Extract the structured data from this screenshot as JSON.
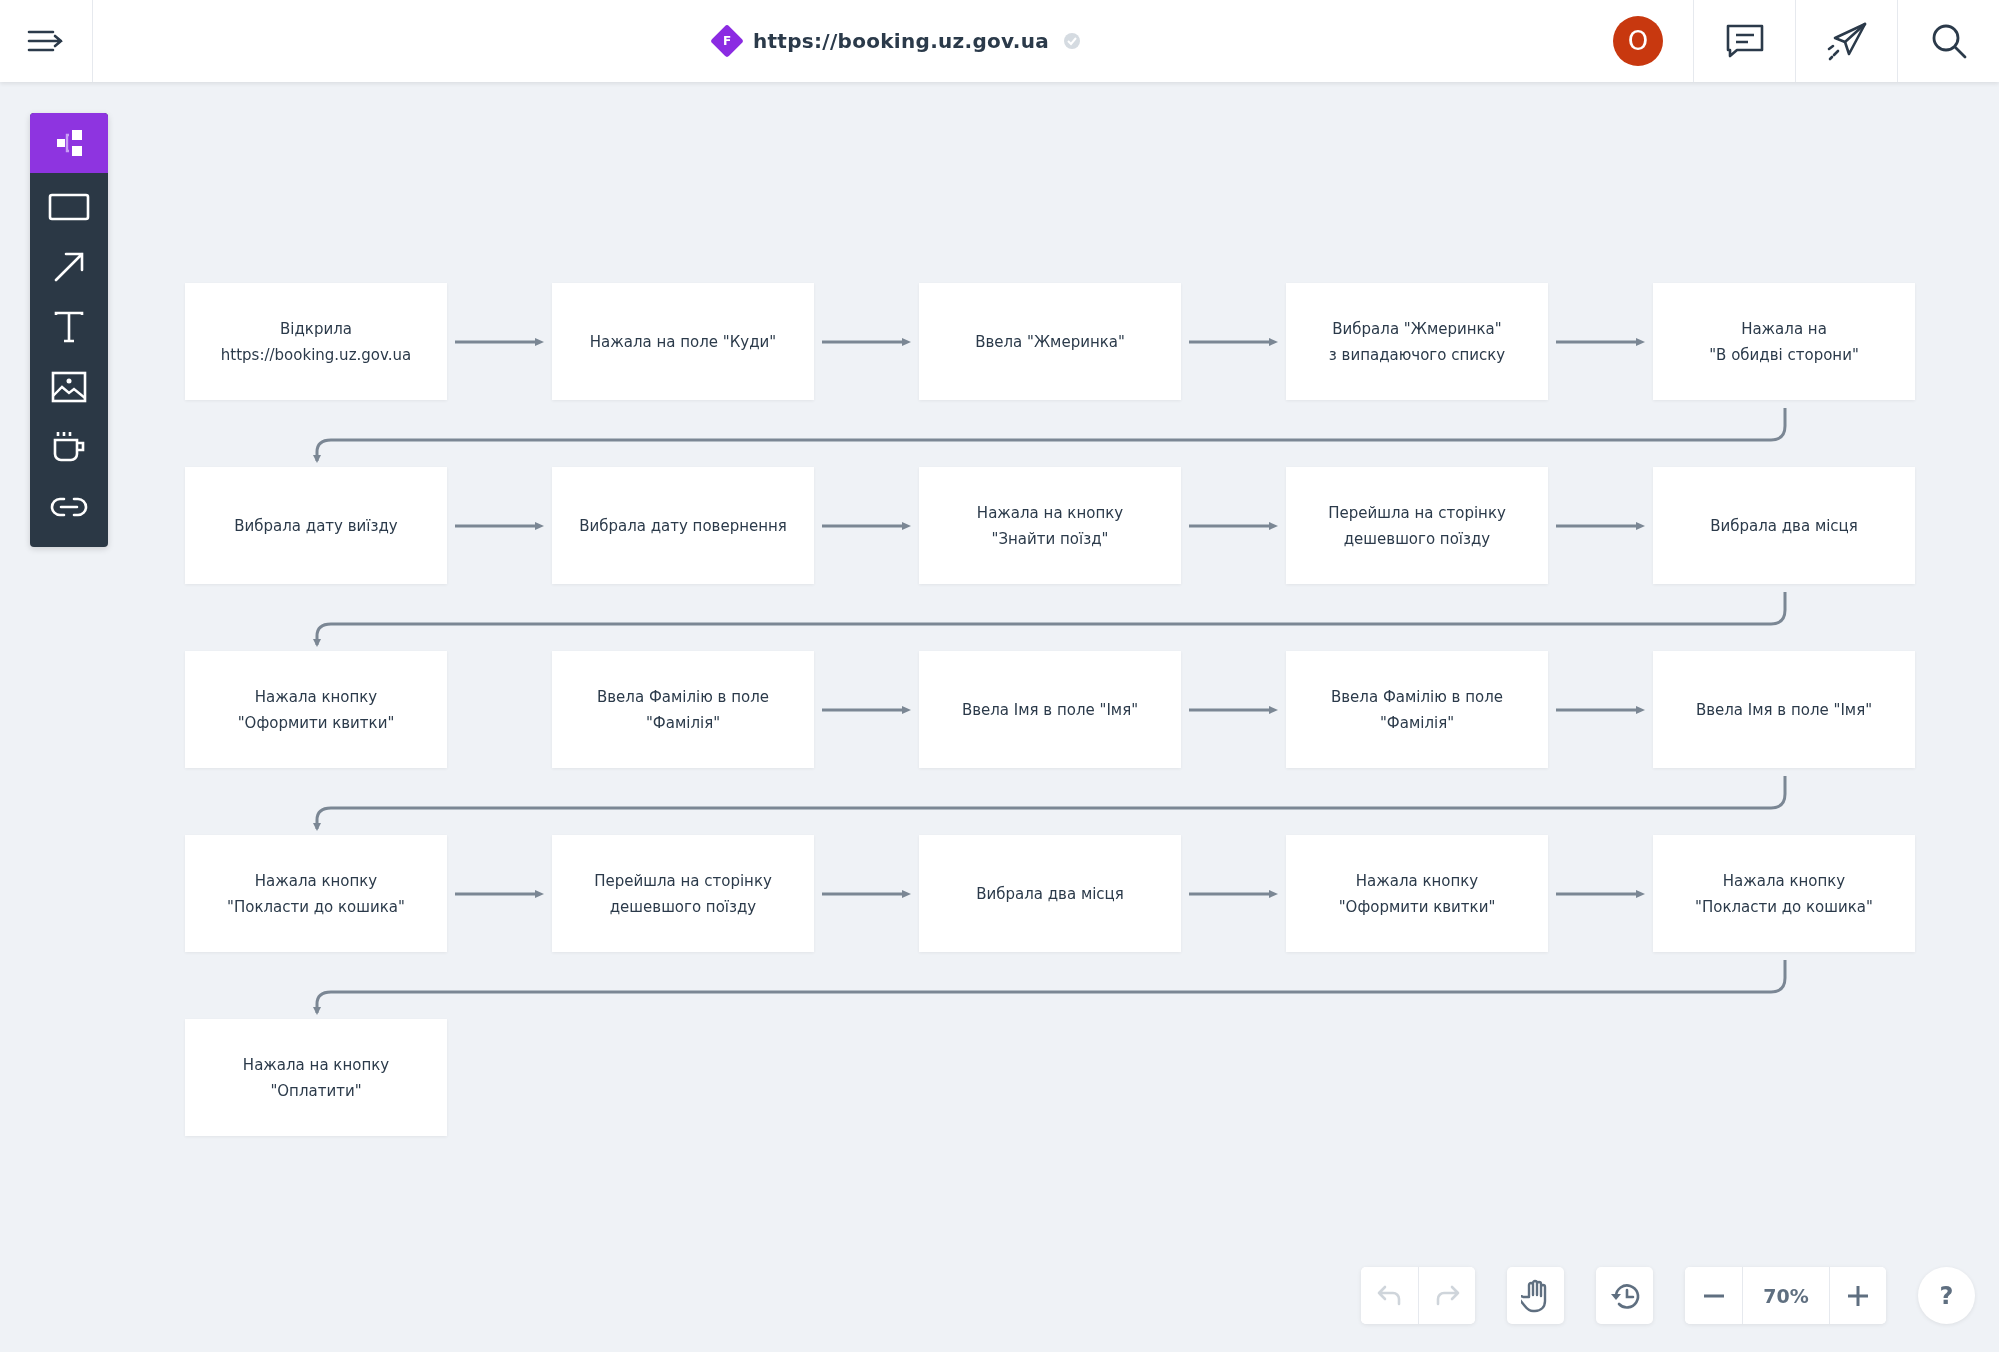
{
  "header": {
    "url": "https://booking.uz.gov.ua",
    "logo_letter": "F",
    "avatar_letter": "O"
  },
  "tools": [
    {
      "kind": "diagram",
      "selected": true
    },
    {
      "kind": "rectangle",
      "selected": false
    },
    {
      "kind": "arrow",
      "selected": false
    },
    {
      "kind": "text",
      "selected": false
    },
    {
      "kind": "image",
      "selected": false
    },
    {
      "kind": "cup",
      "selected": false
    },
    {
      "kind": "link",
      "selected": false
    }
  ],
  "diagram": {
    "rows": [
      {
        "nodes": [
          {
            "text": "Відкрила\nhttps://booking.uz.gov.ua",
            "arrow_to_next": true
          },
          {
            "text": "Нажала на поле \"Куди\"",
            "arrow_to_next": true
          },
          {
            "text": "Ввела \"Жмеринка\"",
            "arrow_to_next": true
          },
          {
            "text": "Вибрала \"Жмеринка\"\nз випадаючого списку",
            "arrow_to_next": true
          },
          {
            "text": "Нажала на\n\"В обидві сторони\"",
            "arrow_to_next": false
          }
        ]
      },
      {
        "nodes": [
          {
            "text": "Вибрала дату виїзду",
            "arrow_to_next": true
          },
          {
            "text": "Вибрала дату повернення",
            "arrow_to_next": true
          },
          {
            "text": "Нажала на кнопку\n\"Знайти поїзд\"",
            "arrow_to_next": true
          },
          {
            "text": "Перейшла на сторінку\nдешевшого поїзду",
            "arrow_to_next": true
          },
          {
            "text": "Вибрала два місця",
            "arrow_to_next": false
          }
        ]
      },
      {
        "nodes": [
          {
            "text": "Нажала кнопку\n\"Оформити квитки\"",
            "arrow_to_next": false
          },
          {
            "text": "Ввела Фамілію в поле\n\"Фамілія\"",
            "arrow_to_next": true
          },
          {
            "text": "Ввела Імя в поле \"Імя\"",
            "arrow_to_next": true
          },
          {
            "text": "Ввела Фамілію в поле\n\"Фамілія\"",
            "arrow_to_next": true
          },
          {
            "text": "Ввела Імя в поле \"Імя\"",
            "arrow_to_next": false
          }
        ]
      },
      {
        "nodes": [
          {
            "text": "Нажала кнопку\n\"Покласти до кошика\"",
            "arrow_to_next": true
          },
          {
            "text": "Перейшла на сторінку\nдешевшого поїзду",
            "arrow_to_next": true
          },
          {
            "text": "Вибрала два місця",
            "arrow_to_next": true
          },
          {
            "text": "Нажала кнопку\n\"Оформити квитки\"",
            "arrow_to_next": true
          },
          {
            "text": "Нажала кнопку\n\"Покласти до кошика\"",
            "arrow_to_next": false
          }
        ]
      },
      {
        "nodes": [
          {
            "text": "Нажала на кнопку\n\"Оплатити\"",
            "arrow_to_next": false
          }
        ]
      }
    ]
  },
  "controls": {
    "undo": {
      "disabled": true
    },
    "redo": {
      "disabled": true
    },
    "zoom": "70%",
    "help": "?"
  }
}
